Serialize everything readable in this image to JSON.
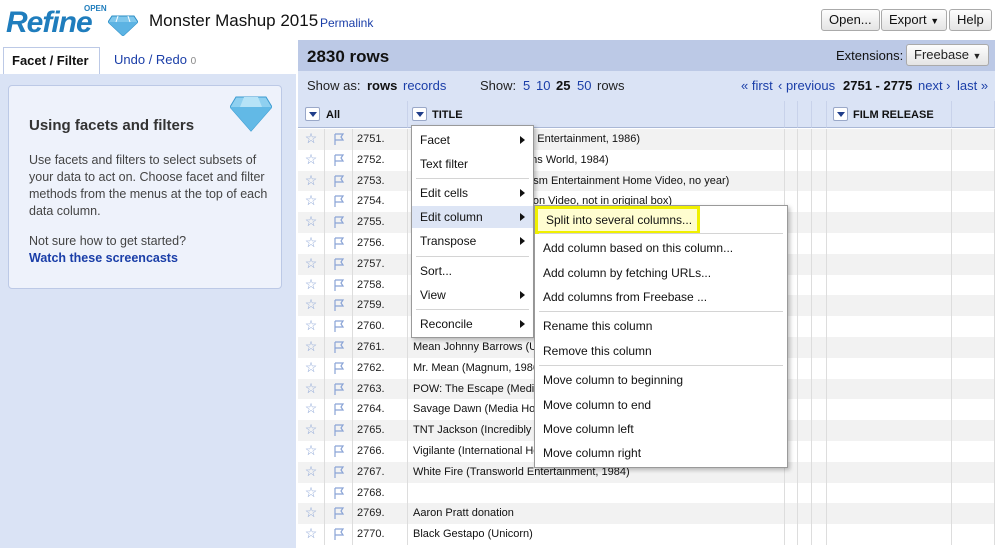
{
  "header": {
    "logo_text": "Refine",
    "logo_sub": "OPEN",
    "project_title": "Monster Mashup 2015",
    "permalink": "Permalink",
    "buttons": {
      "open": "Open...",
      "export": "Export",
      "help": "Help"
    }
  },
  "left": {
    "tabs": {
      "facet": "Facet / Filter",
      "undo": "Undo / Redo",
      "undo_count": "0"
    },
    "help": {
      "title": "Using facets and filters",
      "text": "Use facets and filters to select subsets of your data to act on. Choose facet and filter methods from the menus at the top of each data column.",
      "question": "Not sure how to get started?",
      "link": "Watch these screencasts"
    }
  },
  "summary": {
    "rows": "2830 rows",
    "extensions_label": "Extensions:",
    "extensions_value": "Freebase"
  },
  "view": {
    "show_as_label": "Show as:",
    "rows": "rows",
    "records": "records",
    "show_label": "Show:",
    "sizes": [
      "5",
      "10",
      "25",
      "50"
    ],
    "active_size": "25",
    "rows_suffix": "rows",
    "first": "« first",
    "previous": "‹ previous",
    "range": "2751 - 2775",
    "next": "next ›",
    "last": "last »"
  },
  "columns": {
    "all": "All",
    "title": "TITLE",
    "film_release": "FILM RELEASE"
  },
  "rows": [
    {
      "num": "2751.",
      "title": "Untold Story (Transworld Entertainment, 1986)"
    },
    {
      "num": "2752.",
      "title": "Aliens in the Family (Trans World, 1984)"
    },
    {
      "num": "2753.",
      "title": "Nightmare Weekend (Prism Entertainment Home Video, no year)"
    },
    {
      "num": "2754.",
      "title": "Lost in a Fantasy (Paragon Video, not in original box)"
    },
    {
      "num": "2755.",
      "title": ""
    },
    {
      "num": "2756.",
      "title": ""
    },
    {
      "num": "2757.",
      "title": ""
    },
    {
      "num": "2758.",
      "title": ""
    },
    {
      "num": "2759.",
      "title": ""
    },
    {
      "num": "2760.",
      "title": ""
    },
    {
      "num": "2761.",
      "title": "Mean Johnny Barrows (U"
    },
    {
      "num": "2762.",
      "title": "Mr. Mean (Magnum, 1986"
    },
    {
      "num": "2763.",
      "title": "POW: The Escape (Media"
    },
    {
      "num": "2764.",
      "title": "Savage Dawn (Media Ho"
    },
    {
      "num": "2765.",
      "title": "TNT Jackson (Incredibly"
    },
    {
      "num": "2766.",
      "title": "Vigilante (International Ho"
    },
    {
      "num": "2767.",
      "title": "White Fire (Transworld Entertainment, 1984)"
    },
    {
      "num": "2768.",
      "title": ""
    },
    {
      "num": "2769.",
      "title": "Aaron Pratt donation"
    },
    {
      "num": "2770.",
      "title": "Black Gestapo (Unicorn)"
    }
  ],
  "column_menu": [
    {
      "label": "Facet",
      "sub": true
    },
    {
      "label": "Text filter",
      "sub": false
    },
    {
      "label": "Edit cells",
      "sub": true
    },
    {
      "label": "Edit column",
      "sub": true
    },
    {
      "label": "Transpose",
      "sub": true
    },
    {
      "label": "Sort...",
      "sub": false
    },
    {
      "label": "View",
      "sub": true
    },
    {
      "label": "Reconcile",
      "sub": true
    }
  ],
  "edit_column_menu": [
    "Split into several columns...",
    "Add column based on this column...",
    "Add column by fetching URLs...",
    "Add columns from Freebase ...",
    "Rename this column",
    "Remove this column",
    "Move column to beginning",
    "Move column to end",
    "Move column left",
    "Move column right"
  ],
  "colors": {
    "accent": "#1f7dbd",
    "highlight": "#f0f000",
    "link": "#1a3ea8"
  }
}
